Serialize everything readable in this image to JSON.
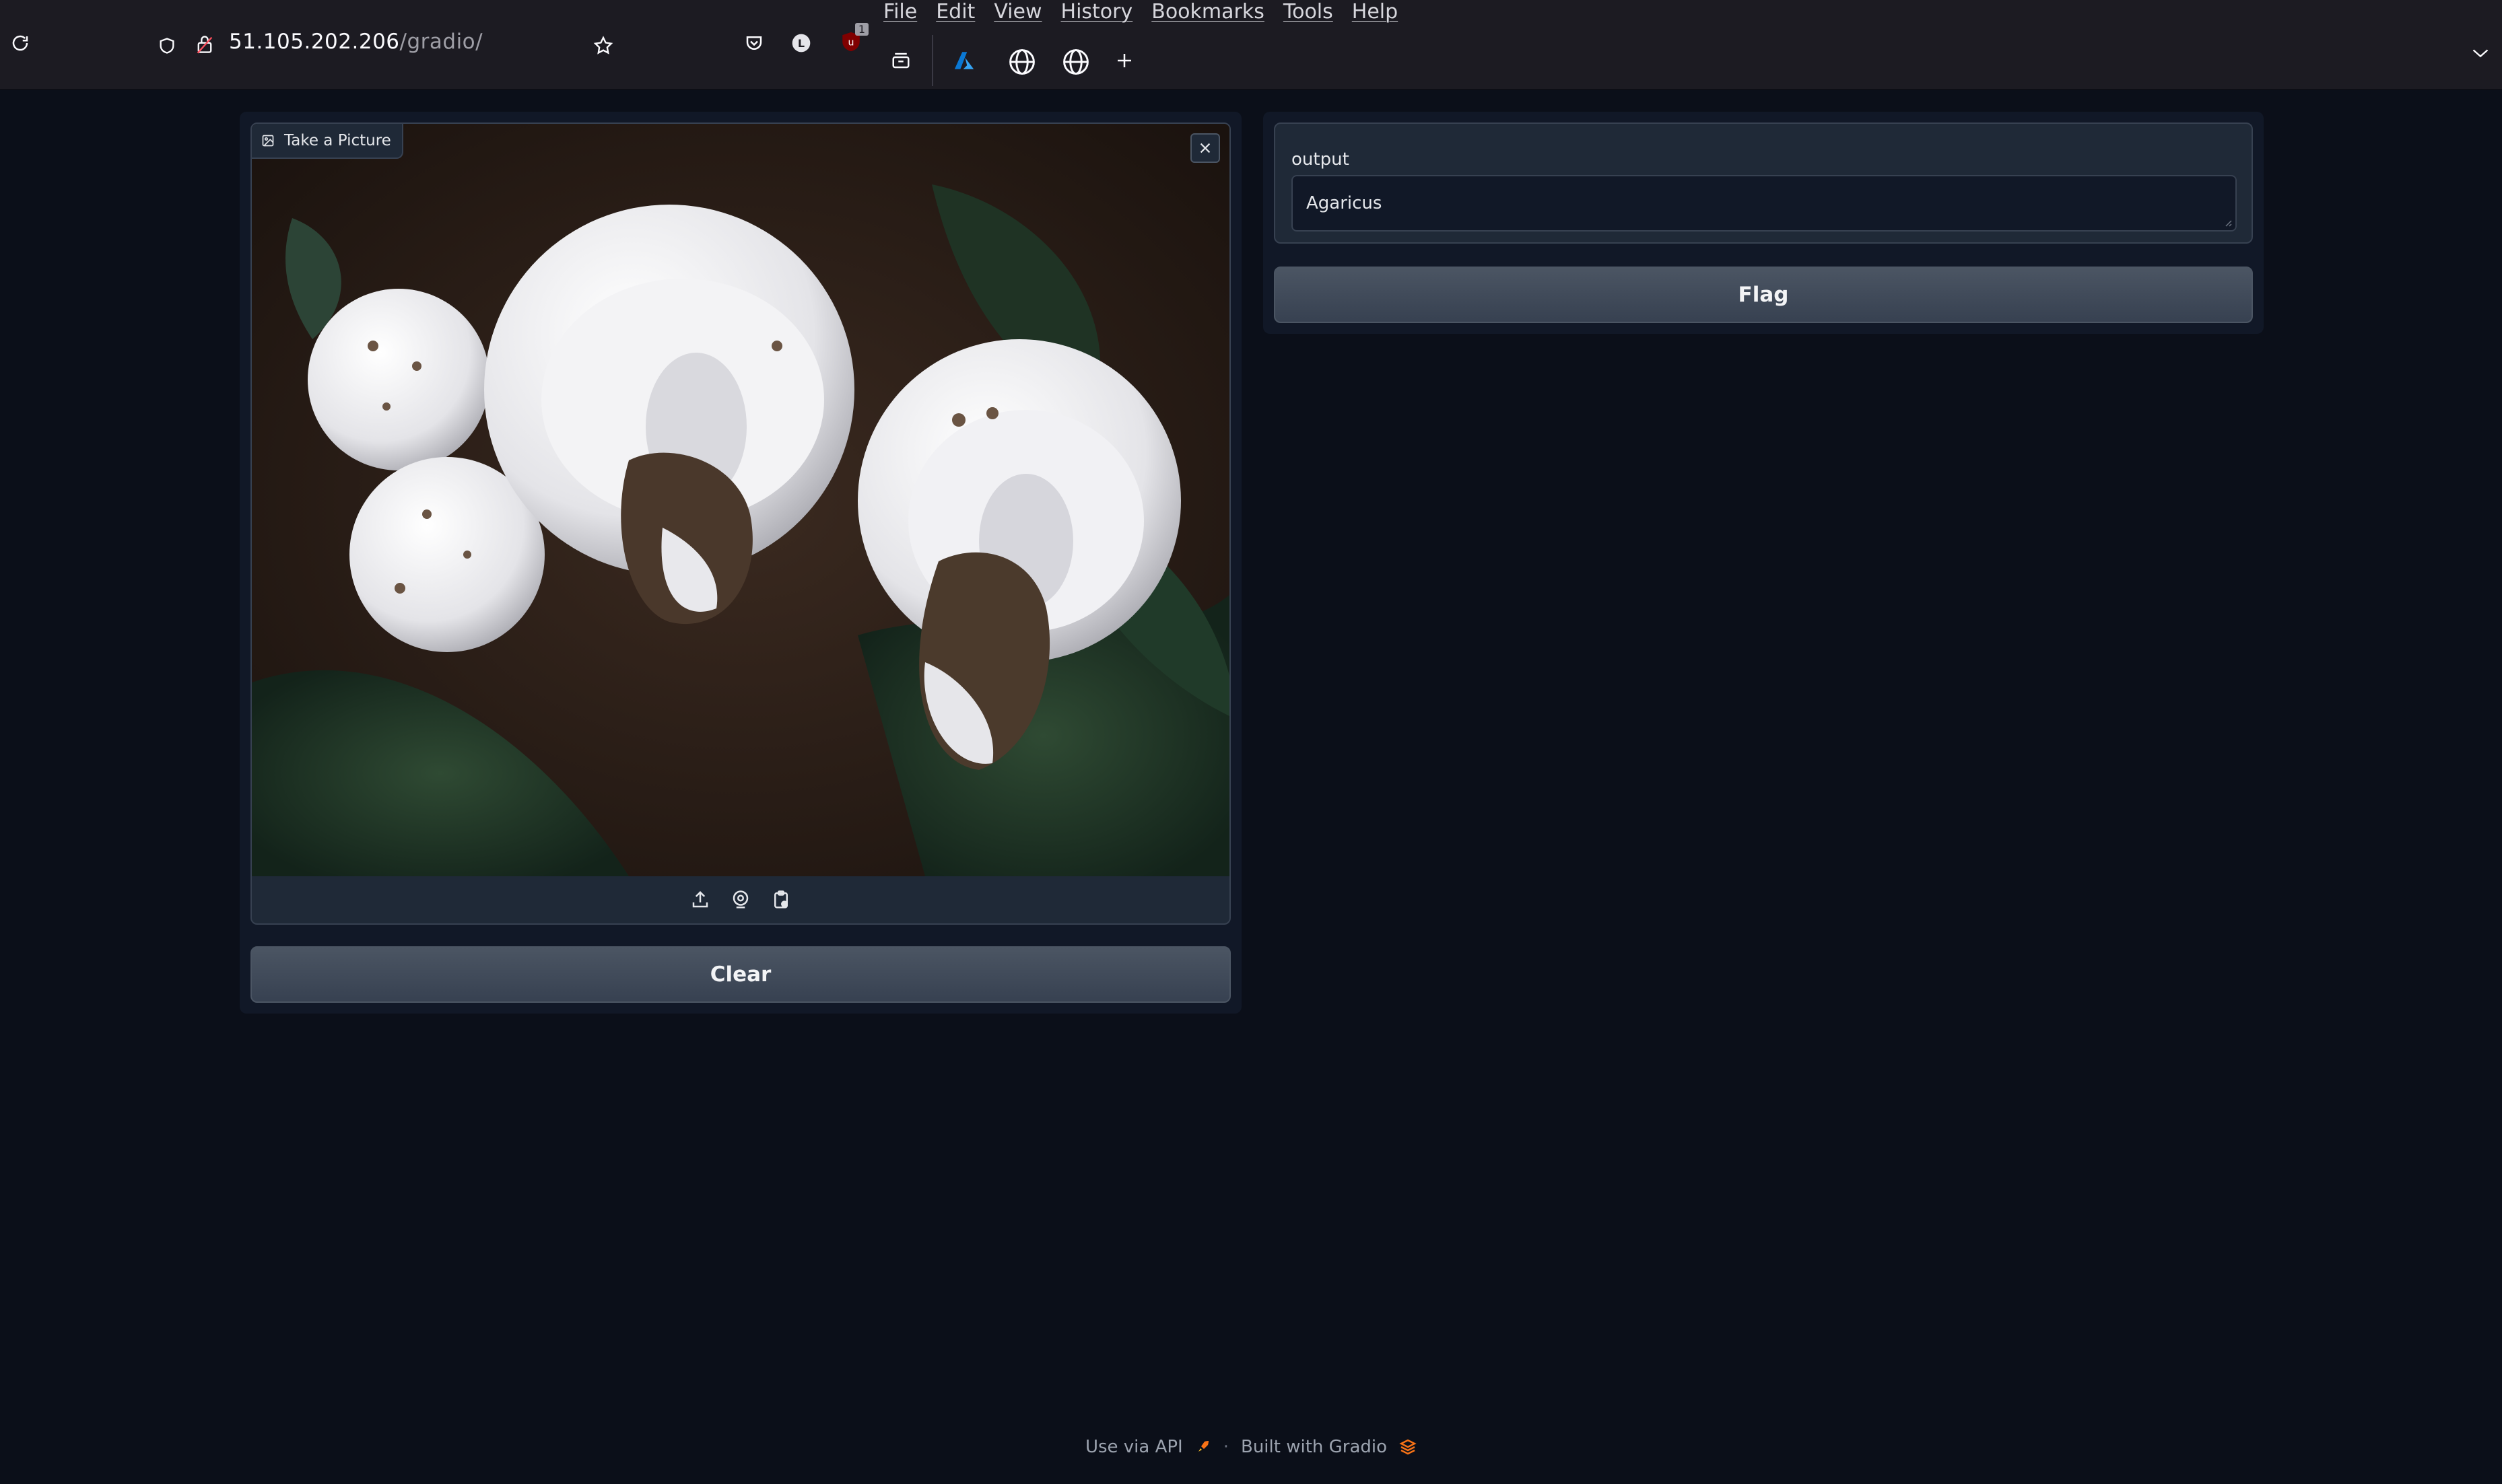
{
  "browser": {
    "url_host": "51.105.202.206",
    "url_path": "/gradio/",
    "menu": [
      "File",
      "Edit",
      "View",
      "History",
      "Bookmarks",
      "Tools",
      "Help"
    ],
    "toolbar_icons": [
      "reload-icon",
      "shield-icon",
      "lock-icon",
      "star-icon",
      "pocket-icon",
      "extension-l-icon",
      "ublock-icon",
      "tab-manager-icon",
      "azure-icon",
      "globe-icon",
      "globe-icon",
      "new-tab-icon",
      "tab-list-chevron-icon"
    ],
    "extension_badge": "1"
  },
  "app": {
    "image_input": {
      "label": "Take a Picture",
      "source_icons": [
        "upload-icon",
        "webcam-icon",
        "clipboard-icon"
      ]
    },
    "clear_label": "Clear",
    "output": {
      "label": "output",
      "value": "Agaricus"
    },
    "flag_label": "Flag"
  },
  "footer": {
    "api_text": "Use via API",
    "separator": "·",
    "built_text": "Built with Gradio"
  },
  "colors": {
    "page_bg": "#0b0f19",
    "panel_bg": "#111827",
    "block_bg": "#1f2937",
    "border": "#374151",
    "button": "#4b5563",
    "accent_orange": "#f97316"
  }
}
